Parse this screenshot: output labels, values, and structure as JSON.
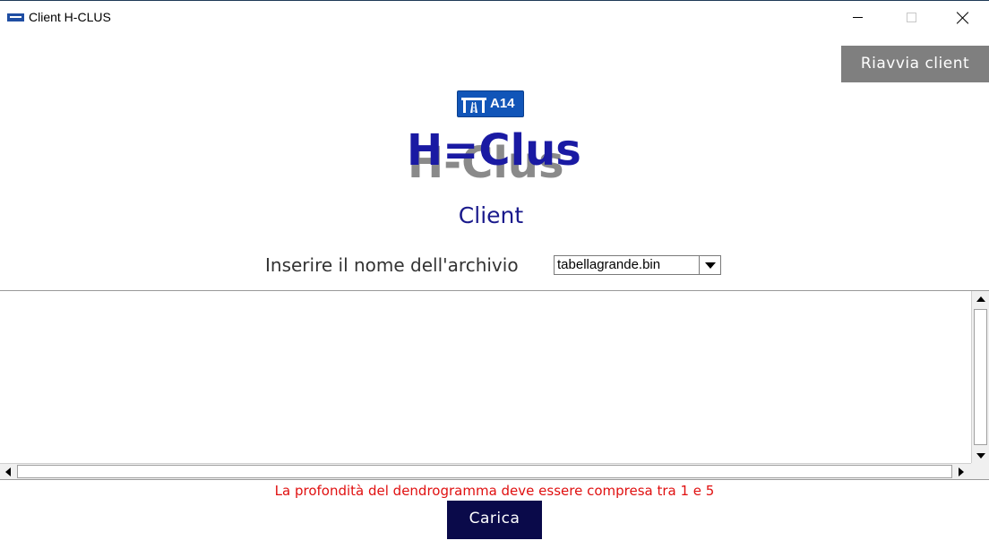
{
  "window": {
    "title": "Client H-CLUS",
    "icon": "app-icon",
    "controls": [
      "minimize",
      "maximize",
      "close"
    ]
  },
  "header": {
    "restart_label": "Riavvia client"
  },
  "logo": {
    "sign_text": "A14",
    "brand_text": "H=Clus",
    "brand_shadow_text": "H-Clus",
    "brand_color": "#1a1aa3",
    "sign_color": "#1155b8"
  },
  "subtitle": "Client",
  "archive": {
    "label": "Inserire il nome dell'archivio",
    "selected": "tabellagrande.bin"
  },
  "output": {
    "text": ""
  },
  "error": {
    "message": "La profondità del dendrogramma deve essere compresa tra 1 e 5",
    "color": "#e01010"
  },
  "actions": {
    "load_label": "Carica"
  }
}
